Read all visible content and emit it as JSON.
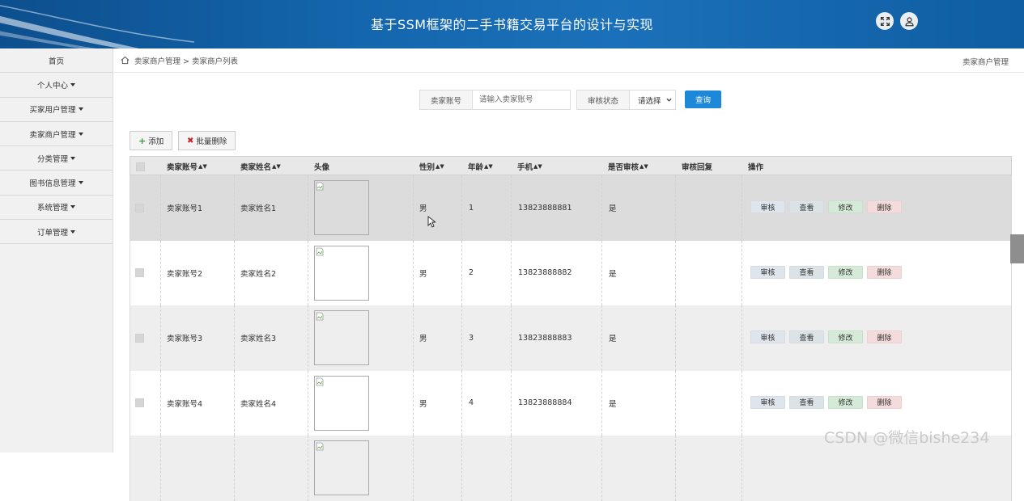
{
  "header": {
    "title": "基于SSM框架的二手书籍交易平台的设计与实现",
    "brand_color": "#1466ad"
  },
  "sidebar": {
    "items": [
      {
        "label": "首页",
        "has_caret": false
      },
      {
        "label": "个人中心",
        "has_caret": true
      },
      {
        "label": "买家用户管理",
        "has_caret": true
      },
      {
        "label": "卖家商户管理",
        "has_caret": true
      },
      {
        "label": "分类管理",
        "has_caret": true
      },
      {
        "label": "图书信息管理",
        "has_caret": true
      },
      {
        "label": "系统管理",
        "has_caret": true
      },
      {
        "label": "订单管理",
        "has_caret": true
      }
    ]
  },
  "breadcrumb": {
    "path": "卖家商户管理 > 卖家商户列表",
    "right_label": "卖家商户管理"
  },
  "search": {
    "account_label": "卖家账号",
    "account_placeholder": "请输入卖家账号",
    "status_label": "审核状态",
    "status_value": "请选择",
    "query_label": "查询",
    "query_color": "#1e88d8"
  },
  "actions": {
    "add_label": "添加",
    "batch_delete_label": "批量删除"
  },
  "table": {
    "columns": [
      "卖家账号",
      "卖家姓名",
      "头像",
      "性别",
      "年龄",
      "手机",
      "是否审核",
      "审核回复",
      "操作"
    ],
    "sortable": [
      true,
      true,
      false,
      true,
      true,
      true,
      true,
      false,
      false
    ],
    "rows": [
      {
        "account": "卖家账号1",
        "name": "卖家姓名1",
        "gender": "男",
        "age": "1",
        "phone": "13823888881",
        "audited": "是",
        "reply": ""
      },
      {
        "account": "卖家账号2",
        "name": "卖家姓名2",
        "gender": "男",
        "age": "2",
        "phone": "13823888882",
        "audited": "是",
        "reply": ""
      },
      {
        "account": "卖家账号3",
        "name": "卖家姓名3",
        "gender": "男",
        "age": "3",
        "phone": "13823888883",
        "audited": "是",
        "reply": ""
      },
      {
        "account": "卖家账号4",
        "name": "卖家姓名4",
        "gender": "男",
        "age": "4",
        "phone": "13823888884",
        "audited": "是",
        "reply": ""
      }
    ],
    "row_buttons": {
      "audit": "审核",
      "view": "查看",
      "edit": "修改",
      "delete": "删除"
    }
  },
  "watermark": "CSDN @微信bishe234"
}
